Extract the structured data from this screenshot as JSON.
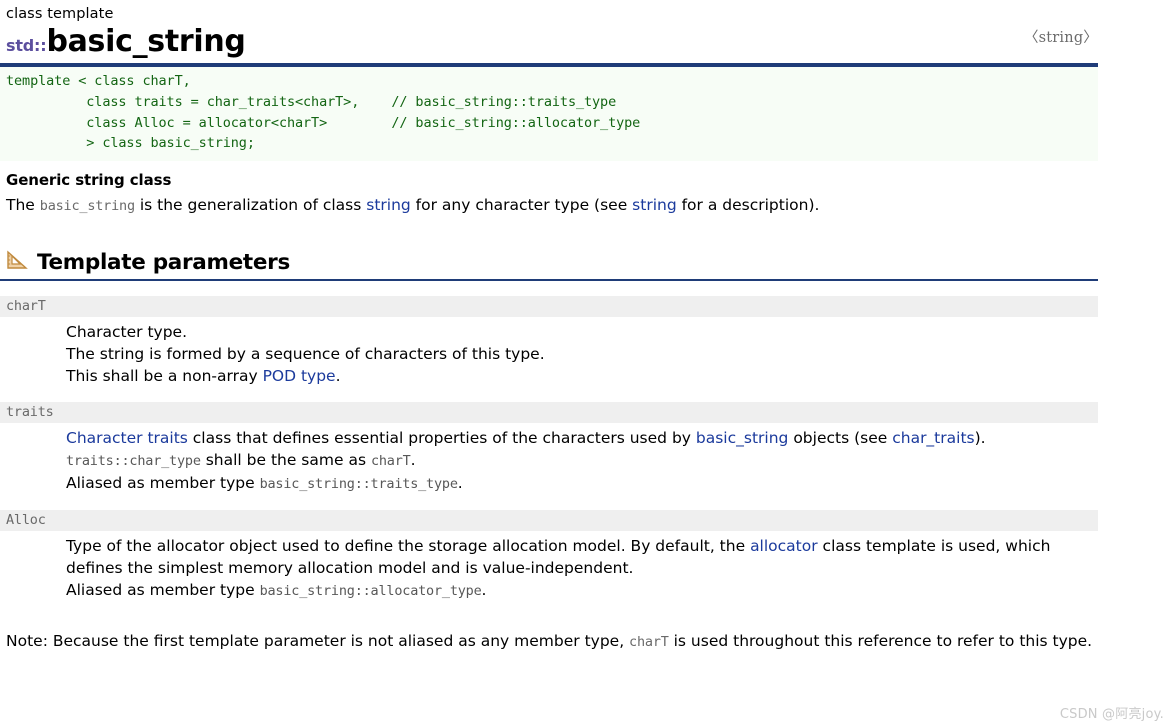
{
  "page": {
    "kicker": "class template",
    "namespace_prefix": "std::",
    "class_name": "basic_string",
    "header_file": "〈string〉"
  },
  "code_block": {
    "lines": [
      "template < class charT,",
      "          class traits = char_traits<charT>,    // basic_string::traits_type",
      "          class Alloc = allocator<charT>        // basic_string::allocator_type",
      "          > class basic_string;"
    ],
    "text": "template < class charT,\n          class traits = char_traits<charT>,    // basic_string::traits_type\n          class Alloc = allocator<charT>        // basic_string::allocator_type\n          > class basic_string;"
  },
  "summary": {
    "heading": "Generic string class",
    "text_1": "The ",
    "code_1": "basic_string",
    "text_2": " is the generalization of class ",
    "link_1": "string",
    "text_3": " for any character type (see ",
    "link_2": "string",
    "text_4": " for a description)."
  },
  "template_parameters": {
    "icon": "set-square-icon",
    "title": "Template parameters",
    "items": [
      {
        "name": "charT",
        "lines": [
          {
            "parts": [
              {
                "t": "Character type.",
                "k": "plain"
              }
            ]
          },
          {
            "parts": [
              {
                "t": "The string is formed by a sequence of characters of this type.",
                "k": "plain"
              }
            ]
          },
          {
            "parts": [
              {
                "t": "This shall be a non-array ",
                "k": "plain"
              },
              {
                "t": "POD type",
                "k": "link"
              },
              {
                "t": ".",
                "k": "plain"
              }
            ]
          }
        ]
      },
      {
        "name": "traits",
        "lines": [
          {
            "parts": [
              {
                "t": "Character traits",
                "k": "link"
              },
              {
                "t": " class that defines essential properties of the characters used by ",
                "k": "plain"
              },
              {
                "t": "basic_string",
                "k": "link"
              },
              {
                "t": " objects (see ",
                "k": "plain"
              },
              {
                "t": "char_traits",
                "k": "link"
              },
              {
                "t": ").",
                "k": "plain"
              }
            ]
          },
          {
            "parts": [
              {
                "t": "traits::char_type",
                "k": "mono"
              },
              {
                "t": " shall be the same as ",
                "k": "plain"
              },
              {
                "t": "charT",
                "k": "mono"
              },
              {
                "t": ".",
                "k": "plain"
              }
            ]
          },
          {
            "parts": [
              {
                "t": "Aliased as member type ",
                "k": "plain"
              },
              {
                "t": "basic_string::traits_type",
                "k": "mono"
              },
              {
                "t": ".",
                "k": "plain"
              }
            ]
          }
        ]
      },
      {
        "name": "Alloc",
        "lines": [
          {
            "parts": [
              {
                "t": "Type of the allocator object used to define the storage allocation model. By default, the ",
                "k": "plain"
              },
              {
                "t": "allocator",
                "k": "link"
              },
              {
                "t": " class template is used, which defines the simplest memory allocation model and is value-independent.",
                "k": "plain"
              }
            ]
          },
          {
            "parts": [
              {
                "t": "Aliased as member type ",
                "k": "plain"
              },
              {
                "t": "basic_string::allocator_type",
                "k": "mono"
              },
              {
                "t": ".",
                "k": "plain"
              }
            ]
          }
        ]
      }
    ]
  },
  "note": {
    "text_1": "Note: Because the first template parameter is not aliased as any member type, ",
    "code_1": "charT",
    "text_2": " is used throughout this reference to refer to this type."
  },
  "watermark": "CSDN @阿亮joy.",
  "colors": {
    "rule_blue": "#1f3c78",
    "link_blue": "#1b3a9c",
    "code_green": "#136513",
    "code_bg": "#f7fdf6",
    "param_bar_bg": "#efefef",
    "namespace_purple": "#5c4f9e",
    "mono_gray": "#6a6a6a",
    "watermark_gray": "#c9c9c9",
    "icon_tan": "#d8a96a"
  }
}
